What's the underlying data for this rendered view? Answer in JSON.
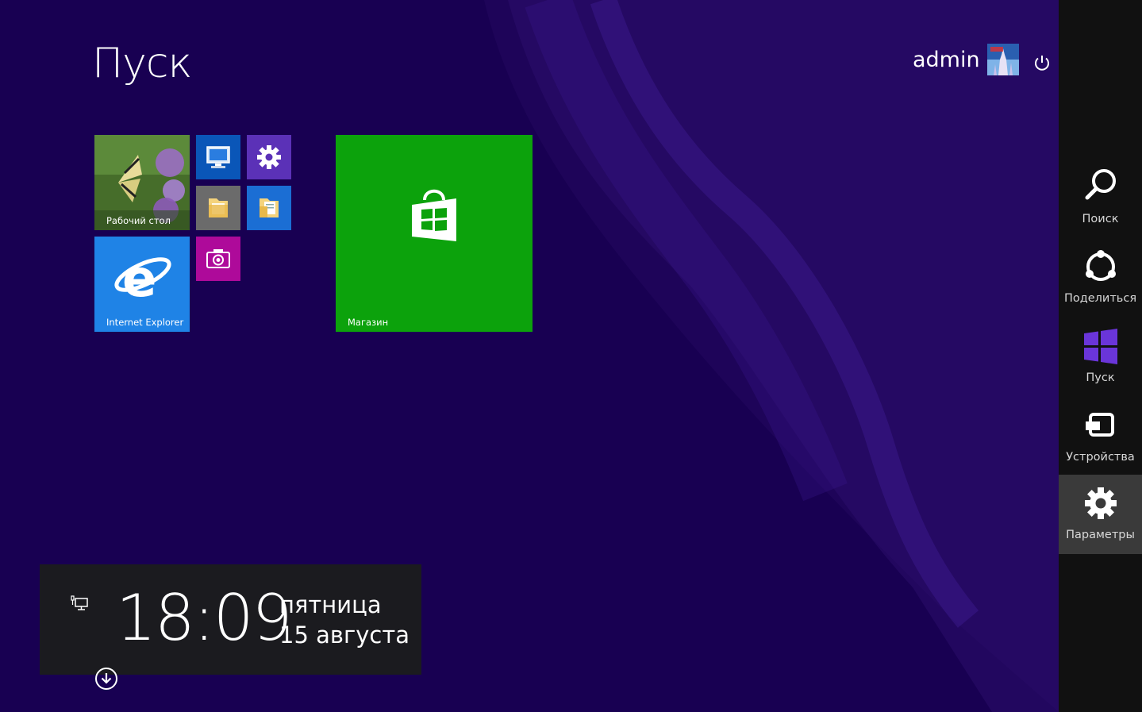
{
  "screen": {
    "title": "Пуск"
  },
  "user": {
    "name": "admin"
  },
  "tiles": {
    "desktop": {
      "label": "Рабочий стол"
    },
    "ie": {
      "label": "Internet Explorer"
    },
    "store": {
      "label": "Магазин"
    }
  },
  "clock": {
    "time": "18:09",
    "day": "пятница",
    "date": "15 августа"
  },
  "charms": [
    {
      "label": "Поиск",
      "icon": "search-icon"
    },
    {
      "label": "Поделиться",
      "icon": "share-icon"
    },
    {
      "label": "Пуск",
      "icon": "windows-logo-icon"
    },
    {
      "label": "Устройства",
      "icon": "devices-icon"
    },
    {
      "label": "Параметры",
      "icon": "gear-icon",
      "active": true
    }
  ],
  "colors": {
    "background": "#180052",
    "store_tile": "#0ca20c",
    "ie_tile": "#1f83e6",
    "camera_tile": "#ae0a9a",
    "charms_bar": "#111111",
    "windows_logo": "#6a35d9"
  }
}
